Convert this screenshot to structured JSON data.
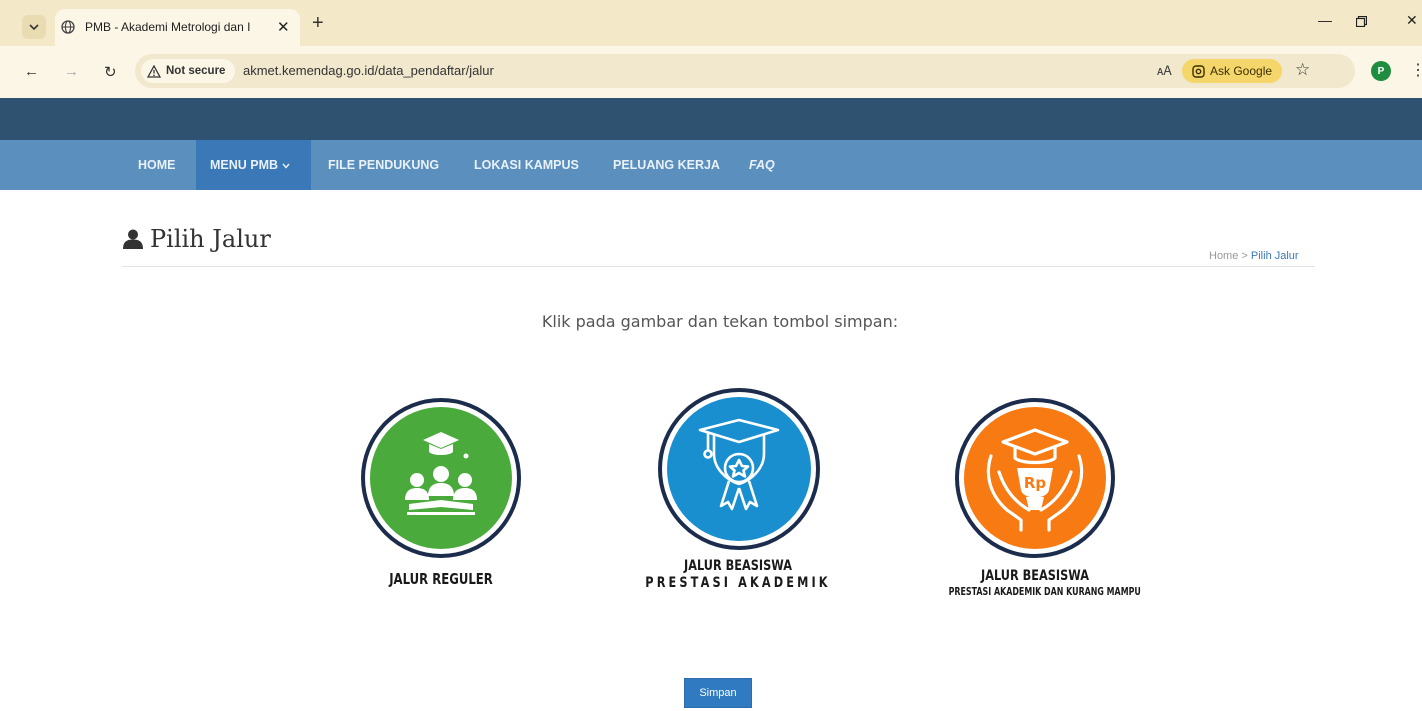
{
  "browser": {
    "tab_title": "PMB - Akademi Metrologi dan I",
    "url": "akmet.kemendag.go.id/data_pendaftar/jalur",
    "not_secure_label": "Not secure",
    "ask_google_label": "Ask Google",
    "profile_initial": "P"
  },
  "nav": {
    "items": [
      {
        "label": "HOME"
      },
      {
        "label": "MENU PMB"
      },
      {
        "label": "FILE PENDUKUNG"
      },
      {
        "label": "LOKASI KAMPUS"
      },
      {
        "label": "PELUANG KERJA"
      },
      {
        "label": "FAQ"
      }
    ],
    "active_index": 1
  },
  "page": {
    "title": "Pilih Jalur",
    "breadcrumb": {
      "home": "Home",
      "separator": ">",
      "current": "Pilih Jalur"
    },
    "instruction": "Klik pada gambar dan tekan tombol simpan:"
  },
  "options": [
    {
      "line1": "JALUR REGULER",
      "line2": "",
      "color": "#4aab3c",
      "icon": "students-graduation-icon"
    },
    {
      "line1": "JALUR BEASISWA",
      "line2": "PRESTASI AKADEMIK",
      "color": "#1a8fd0",
      "icon": "graduation-award-icon"
    },
    {
      "line1": "JALUR BEASISWA",
      "line2": "PRESTASI AKADEMIK DAN KURANG MAMPU",
      "color": "#f77a12",
      "icon": "scholarship-hands-icon",
      "badge": "Rp"
    }
  ],
  "actions": {
    "save_label": "Simpan"
  },
  "colors": {
    "header": "#2e5270",
    "nav": "#5b8fbd",
    "nav_active": "#3a78b8",
    "ring": "#1c2c4c",
    "button": "#2f7ac0"
  }
}
